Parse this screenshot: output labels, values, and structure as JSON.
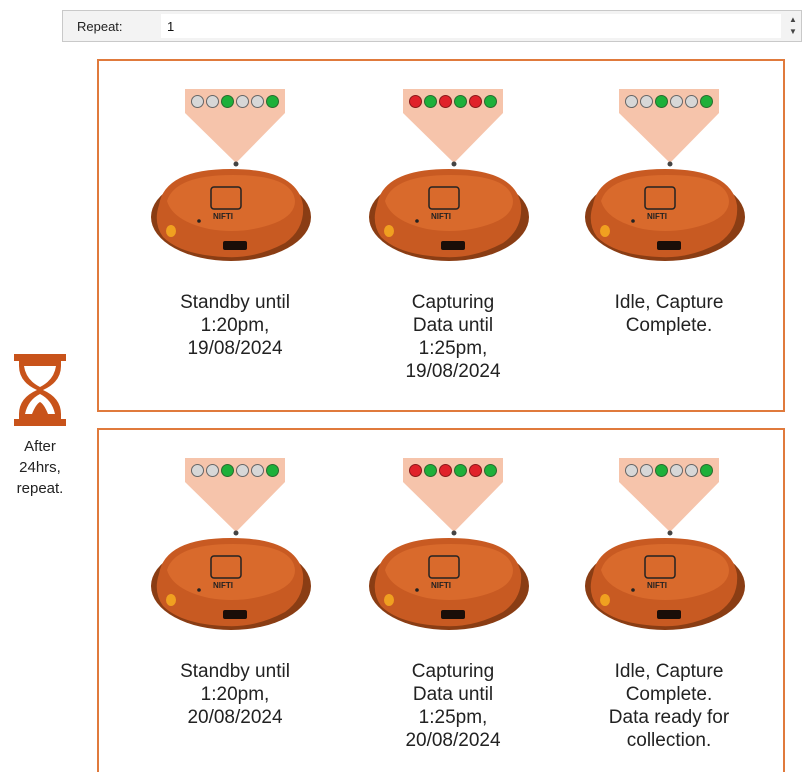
{
  "repeat": {
    "label": "Repeat:",
    "value": "1",
    "spin_up": "▲",
    "spin_down": "▼"
  },
  "side": {
    "text": "After\n24hrs,\nrepeat."
  },
  "device_brand": "NIFTI",
  "led_colors": {
    "off": "#d7d7d7",
    "green": "#1db03a",
    "red": "#e0222a"
  },
  "panels": [
    {
      "cards": [
        {
          "leds": [
            "off",
            "off",
            "green",
            "off",
            "off",
            "green"
          ],
          "caption": "Standby until\n1:20pm,\n19/08/2024"
        },
        {
          "leds": [
            "red",
            "green",
            "red",
            "green",
            "red",
            "green"
          ],
          "caption": "Capturing\nData until\n1:25pm,\n19/08/2024"
        },
        {
          "leds": [
            "off",
            "off",
            "green",
            "off",
            "off",
            "green"
          ],
          "caption": "Idle, Capture\nComplete."
        }
      ]
    },
    {
      "cards": [
        {
          "leds": [
            "off",
            "off",
            "green",
            "off",
            "off",
            "green"
          ],
          "caption": "Standby until\n1:20pm,\n20/08/2024"
        },
        {
          "leds": [
            "red",
            "green",
            "red",
            "green",
            "red",
            "green"
          ],
          "caption": "Capturing\nData until\n1:25pm,\n20/08/2024"
        },
        {
          "leds": [
            "off",
            "off",
            "green",
            "off",
            "off",
            "green"
          ],
          "caption": "Idle, Capture\nComplete.\nData ready for\ncollection."
        }
      ]
    }
  ]
}
